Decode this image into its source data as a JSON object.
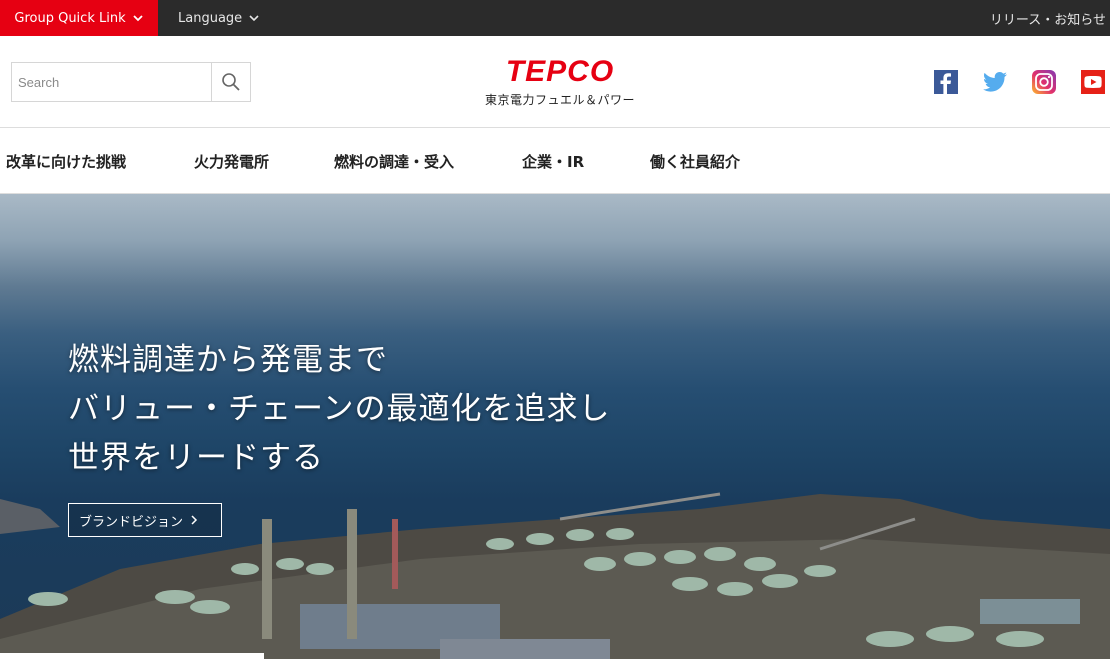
{
  "topbar": {
    "quick_link": "Group Quick Link",
    "language": "Language",
    "news": "リリース・お知らせ"
  },
  "header": {
    "search_placeholder": "Search",
    "logo_mark": "TEPCO",
    "logo_sub": "東京電力フュエル＆パワー",
    "social": [
      "facebook-icon",
      "twitter-icon",
      "instagram-icon",
      "youtube-icon"
    ]
  },
  "nav": {
    "items": [
      "改革に向けた挑戦",
      "火力発電所",
      "燃料の調達・受入",
      "企業・IR",
      "働く社員紹介"
    ]
  },
  "hero": {
    "lines": [
      "燃料調達から発電まで",
      "バリュー・チェーンの最適化を追求し",
      "世界をリードする"
    ],
    "button": "ブランドビジョン"
  },
  "colors": {
    "accent": "#e60012",
    "topbar": "#2b2b2b",
    "facebook": "#3b5998",
    "twitter": "#55acee",
    "youtube": "#e62117"
  }
}
